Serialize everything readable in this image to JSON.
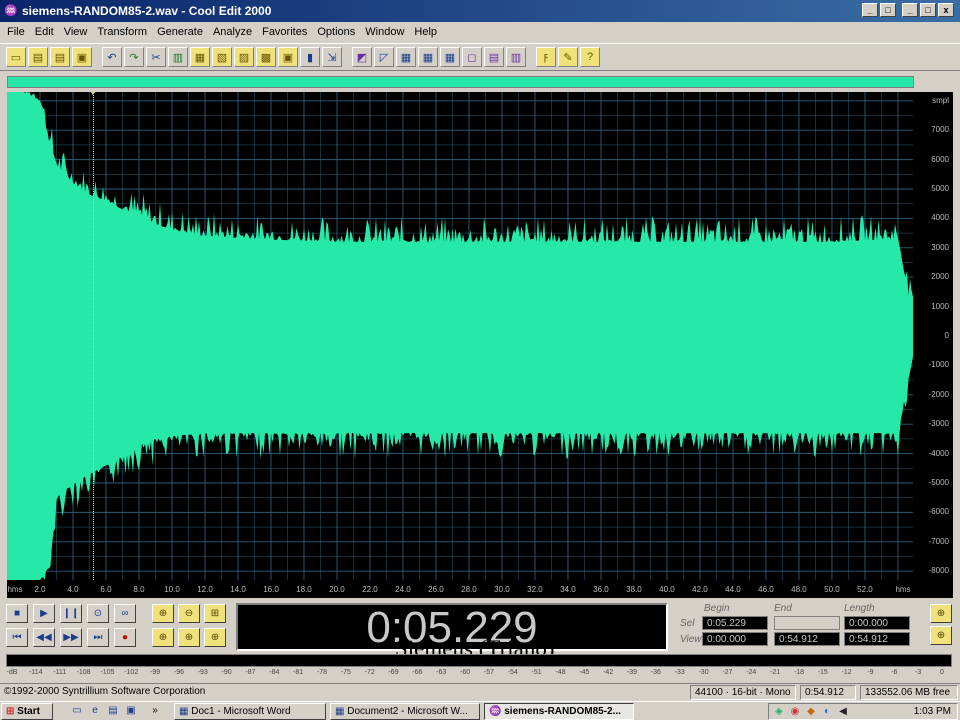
{
  "window": {
    "title": "siemens-RANDOM85-2.wav - Cool Edit 2000",
    "app_icon": "cool-edit-icon",
    "controls": [
      "_",
      "□",
      "x"
    ],
    "doc_controls": [
      "_",
      "□",
      "x"
    ]
  },
  "menu": [
    "File",
    "Edit",
    "View",
    "Transform",
    "Generate",
    "Analyze",
    "Favorites",
    "Options",
    "Window",
    "Help"
  ],
  "toolbar": {
    "icons": [
      "new-file-icon",
      "open-file-icon",
      "close-file-icon",
      "save-icon",
      "sep",
      "undo-icon",
      "repeat-icon",
      "cut-icon",
      "copy-icon",
      "copy-new-icon",
      "paste-icon",
      "paste-new-icon",
      "mix-paste-icon",
      "save-selection-icon",
      "trim-icon",
      "zoom-full-icon",
      "sep",
      "spectral-view-icon",
      "waveform-view-icon",
      "grid-1-icon",
      "grid-2-icon",
      "grid-3-icon",
      "info-icon",
      "cue-list-icon",
      "play-list-icon",
      "sep",
      "settings-icon",
      "scripts-icon",
      "help-icon"
    ],
    "glyphs": [
      "▭",
      "▤",
      "▤",
      "▣",
      "",
      "↶",
      "↷",
      "✂",
      "▥",
      "▦",
      "▧",
      "▨",
      "▩",
      "▣",
      "▮",
      "⇲",
      "",
      "◩",
      "◸",
      "▦",
      "▦",
      "▦",
      "◻",
      "▤",
      "▥",
      "",
      "ϝ",
      "✎",
      "?"
    ]
  },
  "waveform": {
    "color": "#26e8a8",
    "background": "#000000",
    "grid_color": "#2a5f7a",
    "cursor_color": "#e6d94a",
    "cursor_time_s": 5.229
  },
  "chart_data": {
    "type": "area",
    "title": "",
    "xlabel": "hms",
    "ylabel": "smpl",
    "x_unit": "hms",
    "y_unit": "smpl",
    "xlim": [
      0,
      54.912
    ],
    "ylim": [
      -8300,
      8300
    ],
    "x_ticks": [
      "hms",
      "2.0",
      "4.0",
      "6.0",
      "8.0",
      "10.0",
      "12.0",
      "14.0",
      "16.0",
      "18.0",
      "20.0",
      "22.0",
      "24.0",
      "26.0",
      "28.0",
      "30.0",
      "32.0",
      "34.0",
      "36.0",
      "38.0",
      "40.0",
      "42.0",
      "44.0",
      "46.0",
      "48.0",
      "50.0",
      "52.0",
      "hms"
    ],
    "y_ticks": [
      "7000",
      "6000",
      "5000",
      "4000",
      "3000",
      "2000",
      "1000",
      "0",
      "-1000",
      "-2000",
      "-3000",
      "-4000",
      "-5000",
      "-6000",
      "-7000",
      "-8000"
    ],
    "envelope": {
      "x": [
        0,
        1,
        2,
        2.6,
        3,
        4,
        5,
        6,
        7,
        8,
        9,
        10,
        12,
        15,
        20,
        30,
        40,
        50,
        54,
        54.9
      ],
      "upper": [
        8300,
        8300,
        8000,
        6500,
        5800,
        5200,
        4800,
        4600,
        4300,
        4100,
        3800,
        3600,
        3400,
        3300,
        3200,
        3200,
        3200,
        3200,
        3300,
        600
      ],
      "lower": [
        -8300,
        -8300,
        -8300,
        -7800,
        -5500,
        -5000,
        -4700,
        -4400,
        -4100,
        -3700,
        -3500,
        -3400,
        -3300,
        -3300,
        -3300,
        -3300,
        -3300,
        -3300,
        -3300,
        -700
      ]
    }
  },
  "transport": {
    "buttons": [
      {
        "name": "stop-icon",
        "glyph": "■"
      },
      {
        "name": "play-icon",
        "glyph": "▶"
      },
      {
        "name": "pause-icon",
        "glyph": "❙❙"
      },
      {
        "name": "play-to-end-icon",
        "glyph": "⊙"
      },
      {
        "name": "loop-icon",
        "glyph": "∞"
      },
      {
        "name": "go-to-start-icon",
        "glyph": "⏮"
      },
      {
        "name": "rewind-icon",
        "glyph": "◀◀"
      },
      {
        "name": "fast-forward-icon",
        "glyph": "▶▶"
      },
      {
        "name": "go-to-end-icon",
        "glyph": "⏭"
      },
      {
        "name": "record-icon",
        "glyph": "●"
      }
    ],
    "zoom_buttons": [
      {
        "name": "zoom-in-horizontal-icon",
        "glyph": "⊕"
      },
      {
        "name": "zoom-out-horizontal-icon",
        "glyph": "⊖"
      },
      {
        "name": "zoom-full-icon",
        "glyph": "⊞"
      },
      {
        "name": "zoom-to-left-icon",
        "glyph": "⊕"
      },
      {
        "name": "zoom-to-right-icon",
        "glyph": "⊕"
      },
      {
        "name": "zoom-selection-icon",
        "glyph": "⊕"
      }
    ]
  },
  "time_display": "0:05.229",
  "caption": "Siemens (Triano)",
  "selection": {
    "headers": [
      "Begin",
      "End",
      "Length"
    ],
    "rows": [
      {
        "label": "Sel",
        "begin": "0:05.229",
        "end": "",
        "length": "0:00.000"
      },
      {
        "label": "View",
        "begin": "0:00.000",
        "end": "0:54.912",
        "length": "0:54.912"
      }
    ],
    "side_zoom": [
      {
        "name": "zoom-in-vertical-icon",
        "glyph": "⊕"
      },
      {
        "name": "zoom-out-vertical-icon",
        "glyph": "⊕"
      }
    ]
  },
  "level_meter": {
    "scale": [
      "-dB",
      "-114",
      "-111",
      "-108",
      "-105",
      "-102",
      "-99",
      "-96",
      "-93",
      "-90",
      "-87",
      "-84",
      "-81",
      "-78",
      "-75",
      "-72",
      "-69",
      "-66",
      "-63",
      "-60",
      "-57",
      "-54",
      "-51",
      "-48",
      "-45",
      "-42",
      "-39",
      "-36",
      "-33",
      "-30",
      "-27",
      "-24",
      "-21",
      "-18",
      "-15",
      "-12",
      "-9",
      "-6",
      "-3",
      "0"
    ]
  },
  "status": {
    "copyright": "©1992-2000 Syntrillium Software Corporation",
    "format": "44100 · 16-bit · Mono",
    "duration": "0:54.912",
    "free_space": "133552.06 MB free"
  },
  "taskbar": {
    "start": "Start",
    "quick_launch": [
      "show-desktop-icon",
      "internet-explorer-icon",
      "explorer-icon",
      "media-icon"
    ],
    "overflow": "»",
    "tasks": [
      {
        "label": "Doc1 - Microsoft Word",
        "active": false
      },
      {
        "label": "Document2 - Microsoft W...",
        "active": false
      },
      {
        "label": "siemens-RANDOM85-2...",
        "active": true
      }
    ],
    "clock": "1:03 PM"
  }
}
